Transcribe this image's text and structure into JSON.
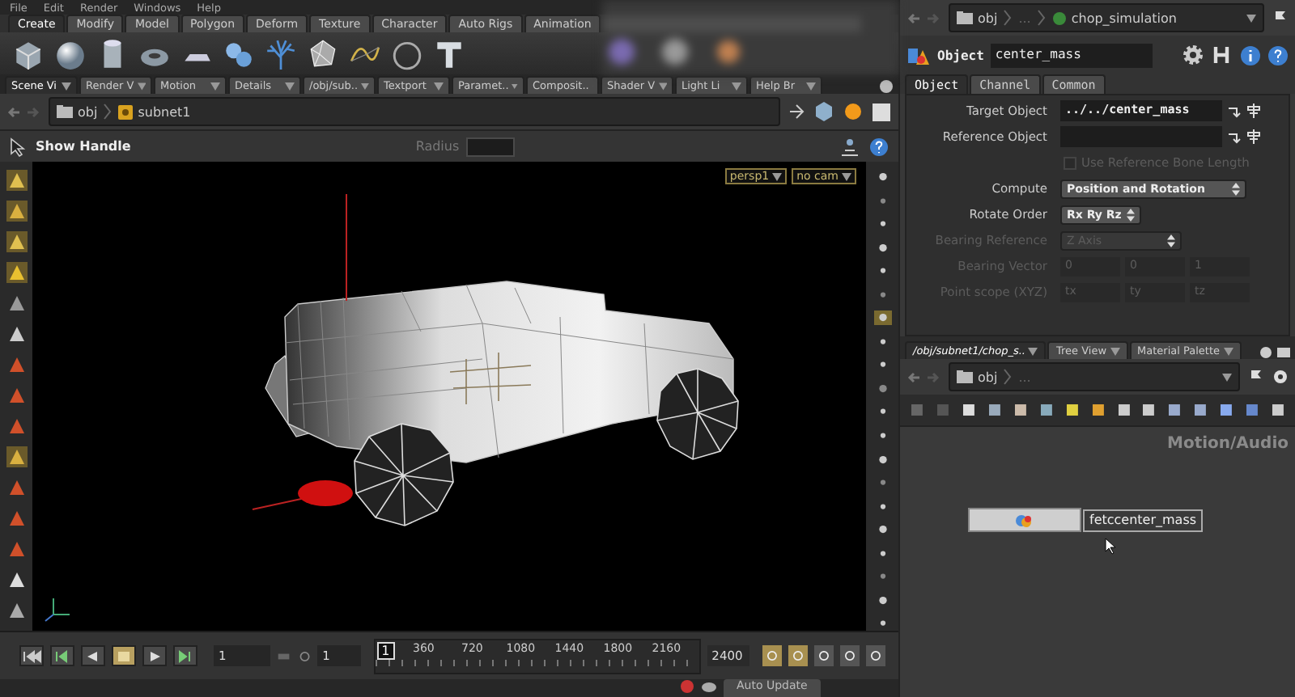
{
  "menu_bar": [
    "File",
    "Edit",
    "Render",
    "Windows",
    "Help"
  ],
  "shelf_tabs": [
    {
      "label": "Create",
      "selected": true
    },
    {
      "label": "Modify",
      "selected": false
    },
    {
      "label": "Model",
      "selected": false
    },
    {
      "label": "Polygon",
      "selected": false
    },
    {
      "label": "Deform",
      "selected": false
    },
    {
      "label": "Texture",
      "selected": false
    },
    {
      "label": "Character",
      "selected": false
    },
    {
      "label": "Auto Rigs",
      "selected": false
    },
    {
      "label": "Animation",
      "selected": false
    }
  ],
  "pane_tabs": [
    {
      "label": "Scene Vi",
      "selected": true
    },
    {
      "label": "Render V",
      "selected": false
    },
    {
      "label": "Motion",
      "selected": false
    },
    {
      "label": "Details",
      "selected": false
    },
    {
      "label": "/obj/sub..",
      "selected": false
    },
    {
      "label": "Textport",
      "selected": false
    },
    {
      "label": "Paramet..",
      "selected": false
    },
    {
      "label": "Composit..",
      "selected": false
    },
    {
      "label": "Shader V",
      "selected": false
    },
    {
      "label": "Light Li",
      "selected": false
    },
    {
      "label": "Help Br",
      "selected": false
    }
  ],
  "path_bar": [
    "obj",
    "subnet1"
  ],
  "operation_bar": {
    "title": "Show Handle",
    "radius_label": "Radius"
  },
  "viewport": {
    "camera_menus": [
      "persp1",
      "no cam"
    ]
  },
  "timeline": {
    "frame": "1",
    "start": "1",
    "current_frame": "1",
    "ticks": [
      "360",
      "720",
      "1080",
      "1440",
      "1800",
      "2160"
    ],
    "end": "2400"
  },
  "status_bar": {
    "auto_update": "Auto Update"
  },
  "parameters": {
    "path": [
      "obj",
      "...",
      "chop_simulation"
    ],
    "type_label": "Object",
    "node_name": "center_mass",
    "tabs": [
      {
        "label": "Object",
        "selected": true
      },
      {
        "label": "Channel",
        "selected": false
      },
      {
        "label": "Common",
        "selected": false
      }
    ],
    "rows": [
      {
        "kind": "field",
        "label": "Target Object",
        "value": "../../center_mass",
        "disabled": false
      },
      {
        "kind": "field",
        "label": "Reference Object",
        "disabled": false
      },
      {
        "kind": "toggle",
        "label": "Use Reference Bone Length",
        "checked": false,
        "disabled": true
      },
      {
        "kind": "menu",
        "label": "Compute",
        "value": "Position and Rotation",
        "disabled": false
      },
      {
        "kind": "menu",
        "label": "Rotate Order",
        "value": "Rx Ry Rz",
        "disabled": false
      },
      {
        "kind": "menu",
        "label": "Bearing Reference",
        "value": "Z Axis",
        "disabled": true
      },
      {
        "kind": "vector",
        "label": "Bearing Vector",
        "values": [
          "0",
          "0",
          "1"
        ],
        "disabled": true
      },
      {
        "kind": "vector",
        "label": "Point scope (XYZ)",
        "values": [
          "tx",
          "ty",
          "tz"
        ],
        "disabled": true
      }
    ]
  },
  "network": {
    "tabs": [
      {
        "label": "/obj/subnet1/chop_s..",
        "selected": true
      },
      {
        "label": "Tree View",
        "selected": false
      },
      {
        "label": "Material Palette",
        "selected": false
      }
    ],
    "path": [
      "obj",
      "..."
    ],
    "context_label": "Motion/Audio",
    "node": {
      "name": "fetccenter_mass"
    }
  }
}
